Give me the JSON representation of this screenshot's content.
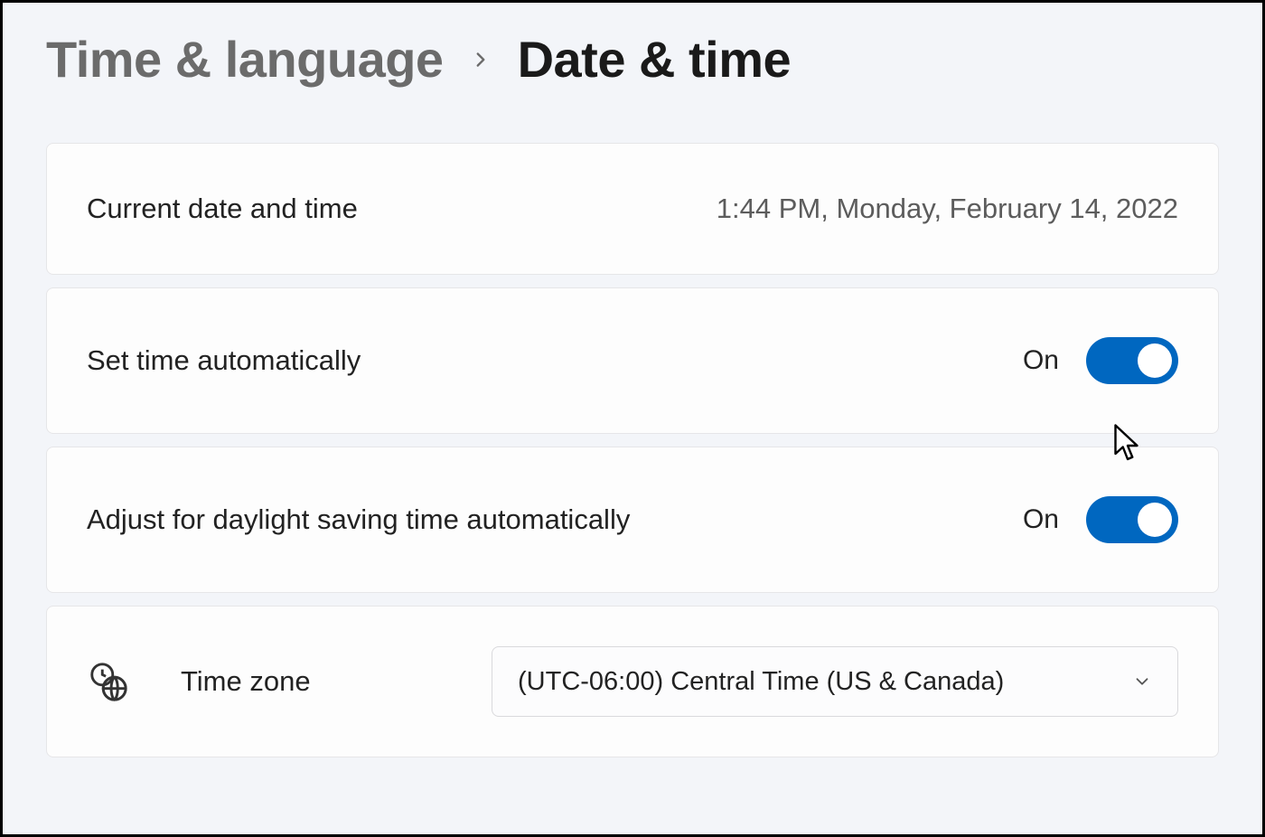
{
  "breadcrumb": {
    "parent": "Time & language",
    "current": "Date & time"
  },
  "current_datetime": {
    "label": "Current date and time",
    "value": "1:44 PM, Monday, February 14, 2022"
  },
  "set_time_auto": {
    "label": "Set time automatically",
    "state": "On"
  },
  "adjust_dst": {
    "label": "Adjust for daylight saving time automatically",
    "state": "On"
  },
  "timezone": {
    "label": "Time zone",
    "value": "(UTC-06:00) Central Time (US & Canada)"
  }
}
